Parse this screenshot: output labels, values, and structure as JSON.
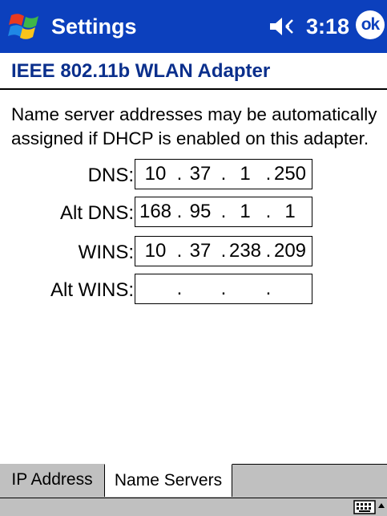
{
  "titlebar": {
    "app_title": "Settings",
    "time": "3:18",
    "ok_label": "ok",
    "start_icon": "windows-flag-icon",
    "speaker_icon": "speaker-icon"
  },
  "header": {
    "adapter_title": "IEEE 802.11b WLAN Adapter"
  },
  "description": "Name server addresses may be automatically assigned if DHCP is enabled on this adapter.",
  "fields": [
    {
      "label": "DNS:",
      "octets": [
        "10",
        "37",
        "1",
        "250"
      ]
    },
    {
      "label": "Alt DNS:",
      "octets": [
        "168",
        "95",
        "1",
        "1"
      ]
    },
    {
      "label": "WINS:",
      "octets": [
        "10",
        "37",
        "238",
        "209"
      ]
    },
    {
      "label": "Alt WINS:",
      "octets": [
        "",
        "",
        "",
        ""
      ]
    }
  ],
  "tabs": [
    {
      "label": "IP Address",
      "active": false
    },
    {
      "label": "Name Servers",
      "active": true
    }
  ],
  "commandbar": {
    "keyboard_icon": "keyboard-icon",
    "arrow_icon": "sip-up-arrow-icon"
  },
  "colors": {
    "titlebar_bg": "#0c40bd",
    "header_text": "#0a2f8c",
    "tab_bg": "#c0c0c0"
  }
}
